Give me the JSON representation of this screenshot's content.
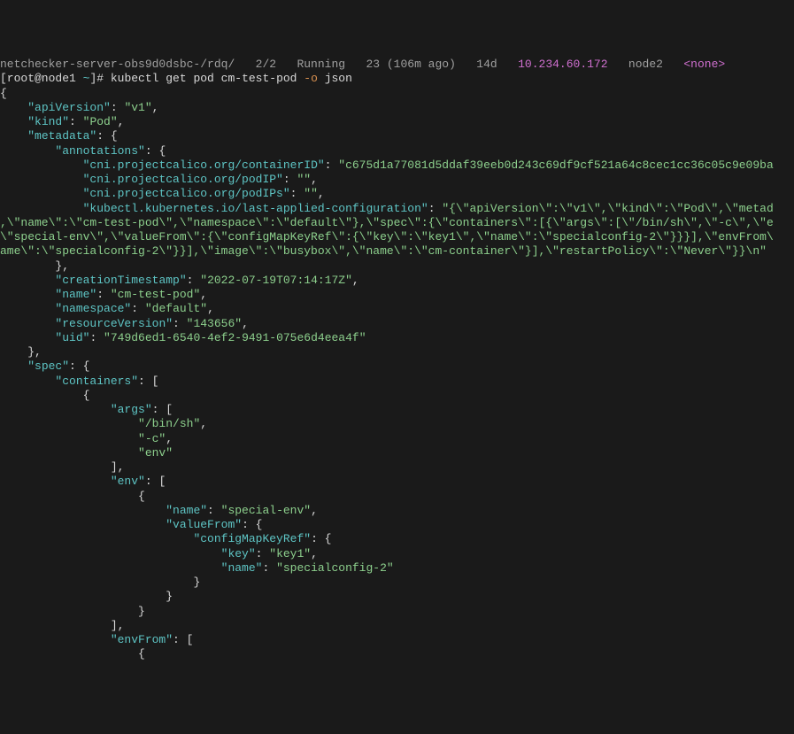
{
  "top_partial": {
    "left": "netchecker-server-obs9d0dsbc-/rdq/   2/2   Running   23 (106m ago)   14d   ",
    "ip": "10.234.60.172",
    "mid": "   node2   ",
    "none": "<none>"
  },
  "prompt": {
    "user_host": "[root@node1 ",
    "tilde": "~",
    "bracket_hash": "]# ",
    "cmd1": "kubectl get pod cm-test-pod ",
    "flag": "-o",
    "cmd2": " json"
  },
  "json_lines": [
    {
      "indent": "",
      "text": "{"
    },
    {
      "indent": "    ",
      "key": "\"apiVersion\"",
      "colon": ": ",
      "val": "\"v1\"",
      "tail": ","
    },
    {
      "indent": "    ",
      "key": "\"kind\"",
      "colon": ": ",
      "val": "\"Pod\"",
      "tail": ","
    },
    {
      "indent": "    ",
      "key": "\"metadata\"",
      "colon": ": ",
      "text2": "{"
    },
    {
      "indent": "        ",
      "key": "\"annotations\"",
      "colon": ": ",
      "text2": "{"
    },
    {
      "indent": "            ",
      "key": "\"cni.projectcalico.org/containerID\"",
      "colon": ": ",
      "val": "\"c675d1a77081d5ddaf39eeb0d243c69df9cf521a64c8cec1cc36c05c9e09ba",
      "tail": ""
    },
    {
      "indent": "            ",
      "key": "\"cni.projectcalico.org/podIP\"",
      "colon": ": ",
      "val": "\"\"",
      "tail": ","
    },
    {
      "indent": "            ",
      "key": "\"cni.projectcalico.org/podIPs\"",
      "colon": ": ",
      "val": "\"\"",
      "tail": ","
    },
    {
      "indent": "            ",
      "key": "\"kubectl.kubernetes.io/last-applied-configuration\"",
      "colon": ": ",
      "val": "\"{\\\"apiVersion\\\":\\\"v1\\\",\\\"kind\\\":\\\"Pod\\\",\\\"metad",
      "tail": "",
      "wrap": true
    },
    {
      "indent": "",
      "text": ",\\\"name\\\":\\\"cm-test-pod\\\",\\\"namespace\\\":\\\"default\\\"},\\\"spec\\\":{\\\"containers\\\":[{\\\"args\\\":[\\\"/bin/sh\\\",\\\"-c\\\",\\\"e",
      "is_val": true
    },
    {
      "indent": "",
      "text": "\\\"special-env\\\",\\\"valueFrom\\\":{\\\"configMapKeyRef\\\":{\\\"key\\\":\\\"key1\\\",\\\"name\\\":\\\"specialconfig-2\\\"}}}],\\\"envFrom\\",
      "is_val": true
    },
    {
      "indent": "",
      "text": "ame\\\":\\\"specialconfig-2\\\"}}],\\\"image\\\":\\\"busybox\\\",\\\"name\\\":\\\"cm-container\\\"}],\\\"restartPolicy\\\":\\\"Never\\\"}}\\n\"",
      "is_val": true
    },
    {
      "indent": "        ",
      "text": "},"
    },
    {
      "indent": "        ",
      "key": "\"creationTimestamp\"",
      "colon": ": ",
      "val": "\"2022-07-19T07:14:17Z\"",
      "tail": ","
    },
    {
      "indent": "        ",
      "key": "\"name\"",
      "colon": ": ",
      "val": "\"cm-test-pod\"",
      "tail": ","
    },
    {
      "indent": "        ",
      "key": "\"namespace\"",
      "colon": ": ",
      "val": "\"default\"",
      "tail": ","
    },
    {
      "indent": "        ",
      "key": "\"resourceVersion\"",
      "colon": ": ",
      "val": "\"143656\"",
      "tail": ","
    },
    {
      "indent": "        ",
      "key": "\"uid\"",
      "colon": ": ",
      "val": "\"749d6ed1-6540-4ef2-9491-075e6d4eea4f\"",
      "tail": ""
    },
    {
      "indent": "    ",
      "text": "},"
    },
    {
      "indent": "    ",
      "key": "\"spec\"",
      "colon": ": ",
      "text2": "{"
    },
    {
      "indent": "        ",
      "key": "\"containers\"",
      "colon": ": ",
      "text2": "["
    },
    {
      "indent": "            ",
      "text": "{"
    },
    {
      "indent": "                ",
      "key": "\"args\"",
      "colon": ": ",
      "text2": "["
    },
    {
      "indent": "                    ",
      "val": "\"/bin/sh\"",
      "tail": ","
    },
    {
      "indent": "                    ",
      "val": "\"-c\"",
      "tail": ","
    },
    {
      "indent": "                    ",
      "val": "\"env\"",
      "tail": ""
    },
    {
      "indent": "                ",
      "text": "],"
    },
    {
      "indent": "                ",
      "key": "\"env\"",
      "colon": ": ",
      "text2": "["
    },
    {
      "indent": "                    ",
      "text": "{"
    },
    {
      "indent": "                        ",
      "key": "\"name\"",
      "colon": ": ",
      "val": "\"special-env\"",
      "tail": ","
    },
    {
      "indent": "                        ",
      "key": "\"valueFrom\"",
      "colon": ": ",
      "text2": "{"
    },
    {
      "indent": "                            ",
      "key": "\"configMapKeyRef\"",
      "colon": ": ",
      "text2": "{"
    },
    {
      "indent": "                                ",
      "key": "\"key\"",
      "colon": ": ",
      "val": "\"key1\"",
      "tail": ","
    },
    {
      "indent": "                                ",
      "key": "\"name\"",
      "colon": ": ",
      "val": "\"specialconfig-2\"",
      "tail": ""
    },
    {
      "indent": "                            ",
      "text": "}"
    },
    {
      "indent": "                        ",
      "text": "}"
    },
    {
      "indent": "                    ",
      "text": "}"
    },
    {
      "indent": "                ",
      "text": "],"
    },
    {
      "indent": "                ",
      "key": "\"envFrom\"",
      "colon": ": ",
      "text2": "["
    },
    {
      "indent": "                    ",
      "text": "{"
    }
  ]
}
